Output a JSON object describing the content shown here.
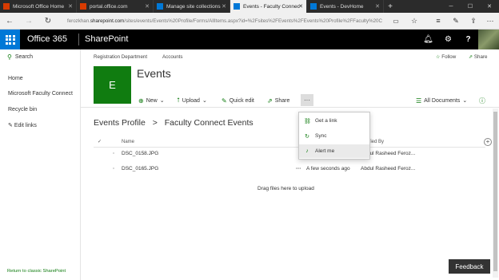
{
  "browser": {
    "tabs": [
      {
        "label": "Microsoft Office Home",
        "icon": "office-icon",
        "active": false
      },
      {
        "label": "portal.office.com",
        "icon": "office-icon",
        "active": false
      },
      {
        "label": "Manage site collections",
        "icon": "sharepoint-icon",
        "active": false
      },
      {
        "label": "Events - Faculty Connec",
        "icon": "sharepoint-icon",
        "active": true
      },
      {
        "label": "Events - DevHome",
        "icon": "sharepoint-icon",
        "active": false
      }
    ],
    "url_prefix": "ferozkhan.",
    "url_domain": "sharepoint.com",
    "url_path": "/sites/events/Events%20Profile/Forms/AllItems.aspx?id=%2Fsites%2FEvents%2FEvents%20Profile%2FFaculty%20C"
  },
  "suite": {
    "app": "Office 365",
    "product": "SharePoint"
  },
  "leftnav": {
    "search": "Search",
    "items": [
      "Home",
      "Microsoft Faculty Connect",
      "Recycle bin"
    ],
    "edit_links": "Edit links",
    "classic": "Return to classic SharePoint"
  },
  "site": {
    "breadcrumb": [
      "Registration Department",
      "Accounts"
    ],
    "follow": "Follow",
    "share": "Share",
    "tile_letter": "E",
    "title": "Events"
  },
  "commands": {
    "new": "New",
    "upload": "Upload",
    "quick_edit": "Quick edit",
    "share": "Share",
    "more": "···",
    "view": "All Documents"
  },
  "library": {
    "crumb_parent": "Events Profile",
    "crumb_sep": ">",
    "crumb_current": "Faculty Connect Events",
    "col_name": "Name",
    "col_modified_by": "dified By",
    "rows": [
      {
        "name": "DSC_0158.JPG",
        "modified": "",
        "modified_by": "Abdul Rasheed Feroz..."
      },
      {
        "name": "DSC_0165.JPG",
        "modified": "A few seconds ago",
        "modified_by": "Abdul Rasheed Feroz..."
      }
    ],
    "drag_text": "Drag files here to upload"
  },
  "context_menu": {
    "items": [
      {
        "label": "Get a link",
        "icon": "link-icon"
      },
      {
        "label": "Sync",
        "icon": "sync-icon"
      },
      {
        "label": "Alert me",
        "icon": "bell-icon"
      }
    ]
  },
  "feedback": "Feedback",
  "colors": {
    "accent": "#107c10",
    "waffle": "#0078d7",
    "suitebar": "#000000"
  }
}
